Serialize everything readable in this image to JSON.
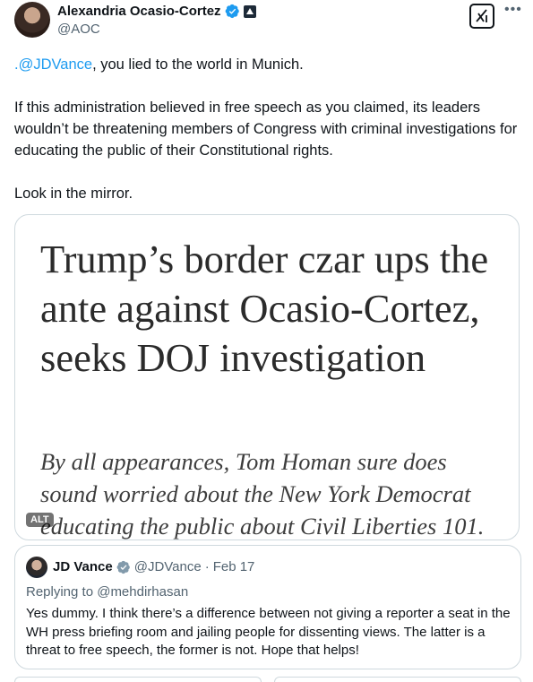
{
  "author": {
    "name": "Alexandria Ocasio-Cortez",
    "handle": "@AOC"
  },
  "icons": {
    "verified": "verified-badge-icon",
    "government": "government-badge-icon",
    "grok": "grok-icon",
    "more": "more-icon"
  },
  "tweet": {
    "mention": ".@JDVance",
    "line1_rest": ", you lied to the world in Munich.",
    "paragraph2": "If this administration believed in free speech as you claimed, its leaders wouldn’t be threatening members of Congress with criminal investigations for educating the public of their Constitutional rights.",
    "paragraph3": "Look in the mirror."
  },
  "media": {
    "headline": "Trump’s border czar ups the ante against Ocasio-Cortez, seeks DOJ investigation",
    "subhead": "By all appearances, Tom Homan sure does sound worried about the New York Democrat educating the public about Civil Liberties 101.",
    "alt_label": "ALT"
  },
  "quote": {
    "name": "JD Vance",
    "handle": "@JDVance",
    "separator": "·",
    "date": "Feb 17",
    "replying_to": "Replying to @mehdirhasan",
    "text": "Yes dummy. I think there’s a difference between not giving a reporter a seat in the WH press briefing room and jailing people for dissenting views. The latter is a threat to free speech, the former is not. Hope that helps!"
  },
  "colors": {
    "link": "#1d9bf0",
    "verified": "#1d9bf0",
    "secondary_text": "#536471",
    "border": "#cfd9de"
  }
}
